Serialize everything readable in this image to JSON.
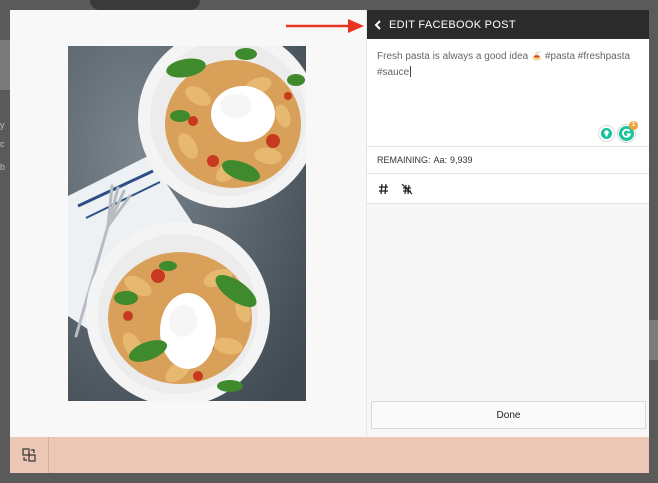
{
  "modal": {
    "title": "EDIT FACEBOOK POST"
  },
  "post": {
    "text_line1": "Fresh pasta is always a good idea",
    "emoji": "🍝",
    "hashtags_line1": "#pasta #freshpasta",
    "hashtags_line2": "#sauce",
    "grammarly_badge": "1"
  },
  "remaining": {
    "label": "REMAINING:",
    "font_glyph": "Aa:",
    "count": "9,939"
  },
  "tools": [
    {
      "name": "hashtag-tool",
      "icon": "hashtag-icon"
    },
    {
      "name": "no-hashtag-tool",
      "icon": "hashtag-off-icon"
    }
  ],
  "actions": {
    "done_label": "Done"
  },
  "backdrop": {
    "text_a": "y",
    "text_b": "c",
    "text_c": "b"
  },
  "colors": {
    "header_bg": "#2b2b2b",
    "footer_bg": "#ecc7b6",
    "annotation_arrow": "#e8331f",
    "grammarly_green": "#15c39a"
  }
}
